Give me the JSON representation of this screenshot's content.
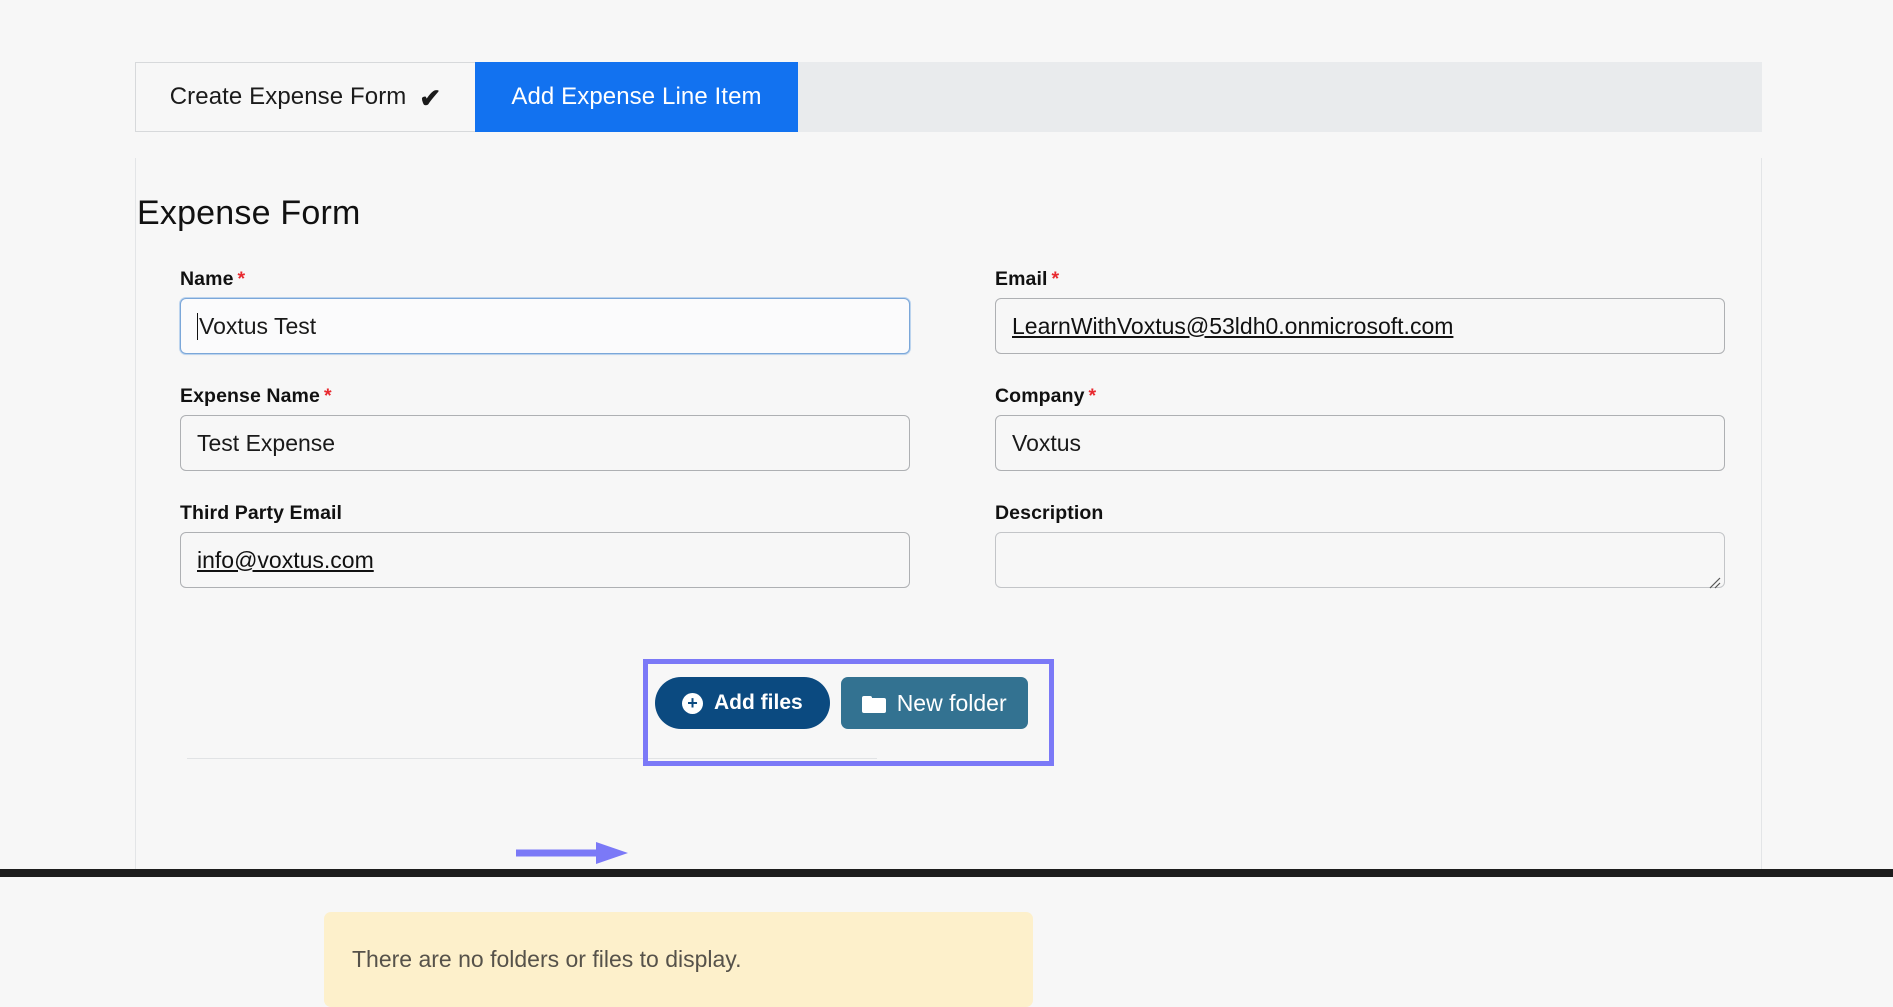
{
  "tabs": [
    {
      "label": "Create Expense Form",
      "state": "completed",
      "icon": "check-icon",
      "check_glyph": "✔"
    },
    {
      "label": "Add Expense Line Item",
      "state": "active"
    }
  ],
  "form": {
    "title": "Expense Form",
    "required_marker": "*",
    "rows": [
      {
        "left": {
          "label": "Name",
          "required": true,
          "value": "Voxtus Test",
          "focused": true,
          "underlined": false,
          "type": "text"
        },
        "right": {
          "label": "Email",
          "required": true,
          "value": "LearnWithVoxtus@53ldh0.onmicrosoft.com",
          "focused": false,
          "underlined": true,
          "type": "text"
        }
      },
      {
        "left": {
          "label": "Expense Name",
          "required": true,
          "value": "Test Expense",
          "focused": false,
          "underlined": false,
          "type": "text"
        },
        "right": {
          "label": "Company",
          "required": true,
          "value": "Voxtus",
          "focused": false,
          "underlined": false,
          "type": "text"
        }
      },
      {
        "left": {
          "label": "Third Party Email",
          "required": false,
          "value": "info@voxtus.com",
          "focused": false,
          "underlined": true,
          "type": "text"
        },
        "right": {
          "label": "Description",
          "required": false,
          "value": "",
          "focused": false,
          "underlined": false,
          "type": "textarea",
          "placeholder": ""
        }
      }
    ]
  },
  "attachments": {
    "add_files_label": "Add files",
    "add_files_icon": "plus-circle-icon",
    "new_folder_label": "New folder",
    "new_folder_icon": "folder-icon",
    "empty_message": "There are no folders or files to display."
  },
  "annotation": {
    "type": "arrow",
    "color": "#7b79f7",
    "highlight_color": "#7b79f7",
    "points_to": "Add files"
  },
  "colors": {
    "active_tab": "#1272f0",
    "tabstrip_bg": "#e9ebed",
    "page_bg": "#f7f7f7",
    "required_star": "#e8292f",
    "add_files_bg": "#0b4a80",
    "new_folder_bg": "#337291",
    "notice_bg": "#fdf0cb",
    "annotation": "#7b79f7"
  }
}
